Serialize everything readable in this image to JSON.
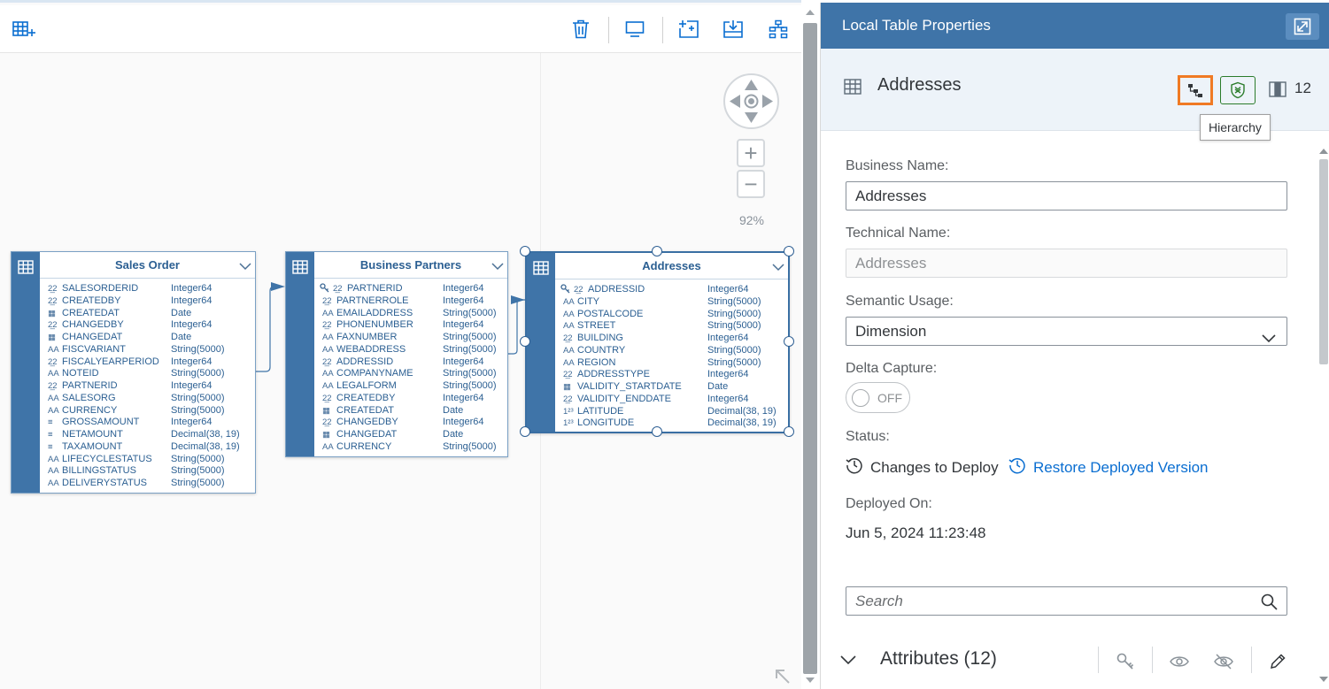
{
  "canvas": {
    "zoom_level": "92%",
    "entities": [
      {
        "title": "Sales Order",
        "rows": [
          {
            "type_icon": "2̲2",
            "name": "SALESORDERID",
            "type": "Integer64",
            "key": false
          },
          {
            "type_icon": "2̲2",
            "name": "CREATEDBY",
            "type": "Integer64",
            "key": false
          },
          {
            "type_icon": "▦",
            "name": "CREATEDAT",
            "type": "Date",
            "key": false
          },
          {
            "type_icon": "2̲2",
            "name": "CHANGEDBY",
            "type": "Integer64",
            "key": false
          },
          {
            "type_icon": "▦",
            "name": "CHANGEDAT",
            "type": "Date",
            "key": false
          },
          {
            "type_icon": "AA",
            "name": "FISCVARIANT",
            "type": "String(5000)",
            "key": false
          },
          {
            "type_icon": "2̲2",
            "name": "FISCALYEARPERIOD",
            "type": "Integer64",
            "key": false
          },
          {
            "type_icon": "AA",
            "name": "NOTEID",
            "type": "String(5000)",
            "key": false
          },
          {
            "type_icon": "2̲2",
            "name": "PARTNERID",
            "type": "Integer64",
            "key": false
          },
          {
            "type_icon": "AA",
            "name": "SALESORG",
            "type": "String(5000)",
            "key": false
          },
          {
            "type_icon": "AA",
            "name": "CURRENCY",
            "type": "String(5000)",
            "key": false
          },
          {
            "type_icon": "≡",
            "name": "GROSSAMOUNT",
            "type": "Integer64",
            "key": false
          },
          {
            "type_icon": "≡",
            "name": "NETAMOUNT",
            "type": "Decimal(38, 19)",
            "key": false
          },
          {
            "type_icon": "≡",
            "name": "TAXAMOUNT",
            "type": "Decimal(38, 19)",
            "key": false
          },
          {
            "type_icon": "AA",
            "name": "LIFECYCLESTATUS",
            "type": "String(5000)",
            "key": false
          },
          {
            "type_icon": "AA",
            "name": "BILLINGSTATUS",
            "type": "String(5000)",
            "key": false
          },
          {
            "type_icon": "AA",
            "name": "DELIVERYSTATUS",
            "type": "String(5000)",
            "key": false
          }
        ]
      },
      {
        "title": "Business Partners",
        "rows": [
          {
            "type_icon": "2̲2",
            "name": "PARTNERID",
            "type": "Integer64",
            "key": true
          },
          {
            "type_icon": "2̲2",
            "name": "PARTNERROLE",
            "type": "Integer64",
            "key": false
          },
          {
            "type_icon": "AA",
            "name": "EMAILADDRESS",
            "type": "String(5000)",
            "key": false
          },
          {
            "type_icon": "2̲2",
            "name": "PHONENUMBER",
            "type": "Integer64",
            "key": false
          },
          {
            "type_icon": "AA",
            "name": "FAXNUMBER",
            "type": "String(5000)",
            "key": false
          },
          {
            "type_icon": "AA",
            "name": "WEBADDRESS",
            "type": "String(5000)",
            "key": false
          },
          {
            "type_icon": "2̲2",
            "name": "ADDRESSID",
            "type": "Integer64",
            "key": false
          },
          {
            "type_icon": "AA",
            "name": "COMPANYNAME",
            "type": "String(5000)",
            "key": false
          },
          {
            "type_icon": "AA",
            "name": "LEGALFORM",
            "type": "String(5000)",
            "key": false
          },
          {
            "type_icon": "2̲2",
            "name": "CREATEDBY",
            "type": "Integer64",
            "key": false
          },
          {
            "type_icon": "▦",
            "name": "CREATEDAT",
            "type": "Date",
            "key": false
          },
          {
            "type_icon": "2̲2",
            "name": "CHANGEDBY",
            "type": "Integer64",
            "key": false
          },
          {
            "type_icon": "▦",
            "name": "CHANGEDAT",
            "type": "Date",
            "key": false
          },
          {
            "type_icon": "AA",
            "name": "CURRENCY",
            "type": "String(5000)",
            "key": false
          }
        ]
      },
      {
        "title": "Addresses",
        "rows": [
          {
            "type_icon": "2̲2",
            "name": "ADDRESSID",
            "type": "Integer64",
            "key": true
          },
          {
            "type_icon": "AA",
            "name": "CITY",
            "type": "String(5000)",
            "key": false
          },
          {
            "type_icon": "AA",
            "name": "POSTALCODE",
            "type": "String(5000)",
            "key": false
          },
          {
            "type_icon": "AA",
            "name": "STREET",
            "type": "String(5000)",
            "key": false
          },
          {
            "type_icon": "2̲2",
            "name": "BUILDING",
            "type": "Integer64",
            "key": false
          },
          {
            "type_icon": "AA",
            "name": "COUNTRY",
            "type": "String(5000)",
            "key": false
          },
          {
            "type_icon": "AA",
            "name": "REGION",
            "type": "String(5000)",
            "key": false
          },
          {
            "type_icon": "2̲2",
            "name": "ADDRESSTYPE",
            "type": "Integer64",
            "key": false
          },
          {
            "type_icon": "▦",
            "name": "VALIDITY_STARTDATE",
            "type": "Date",
            "key": false
          },
          {
            "type_icon": "2̲2",
            "name": "VALIDITY_ENDDATE",
            "type": "Integer64",
            "key": false
          },
          {
            "type_icon": "1²³",
            "name": "LATITUDE",
            "type": "Decimal(38, 19)",
            "key": false
          },
          {
            "type_icon": "1²³",
            "name": "LONGITUDE",
            "type": "Decimal(38, 19)",
            "key": false
          }
        ]
      }
    ]
  },
  "panel": {
    "title": "Local Table Properties",
    "entity_name": "Addresses",
    "column_count": "12",
    "tooltip": "Hierarchy",
    "business_name_label": "Business Name:",
    "business_name_value": "Addresses",
    "technical_name_label": "Technical Name:",
    "technical_name_value": "Addresses",
    "semantic_usage_label": "Semantic Usage:",
    "semantic_usage_value": "Dimension",
    "delta_capture_label": "Delta Capture:",
    "delta_capture_state": "OFF",
    "status_label": "Status:",
    "status_value": "Changes to Deploy",
    "restore_link": "Restore Deployed Version",
    "deployed_on_label": "Deployed On:",
    "deployed_on_value": "Jun 5, 2024 11:23:48",
    "search_placeholder": "Search",
    "attributes_title": "Attributes (12)"
  },
  "colors": {
    "header_blue": "#3f74a8",
    "accent_orange": "#f07a24",
    "link_blue": "#0a6ed1",
    "shield_green": "#2b7c2b"
  }
}
